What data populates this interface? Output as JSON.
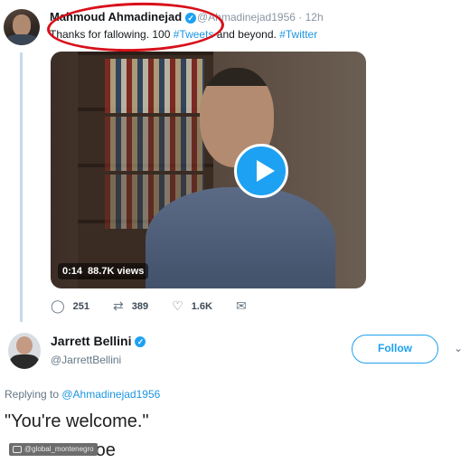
{
  "tweet1": {
    "name": "Mahmoud Ahmadinejad",
    "handle_time": "@Ahmadinejad1956 · 12h",
    "text_before": "Thanks for fallowing. 100 ",
    "hashtag1": "#Tweets",
    "text_mid": " and beyond. ",
    "hashtag2": "#Twitter",
    "video": {
      "time": "0:14",
      "views": "88.7K views",
      "play_icon": "play-icon"
    },
    "actions": {
      "replies": "251",
      "retweets": "389",
      "likes": "1.6K"
    }
  },
  "tweet2": {
    "name": "Jarrett Bellini",
    "handle": "@JarrettBellini",
    "follow_label": "Follow",
    "replying_prefix": "Replying to ",
    "replying_to": "@Ahmadinejad1956",
    "line1": "\"You're welcome.\"",
    "line2": "-Farmer Joe"
  },
  "watermark": "@global_montenegro",
  "colors": {
    "accent": "#1da1f2",
    "annotation": "#d8101a",
    "thread_line": "#c4d9ec"
  }
}
